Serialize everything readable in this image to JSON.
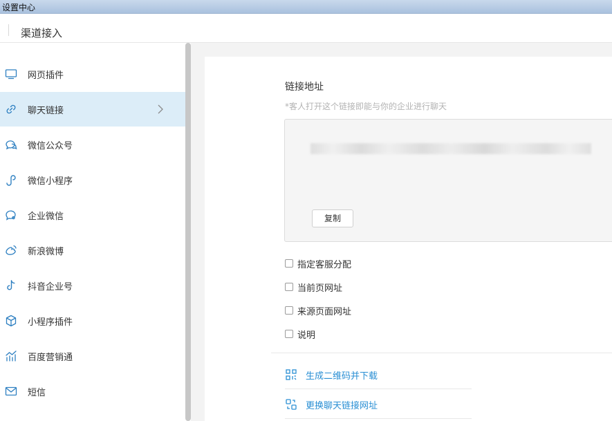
{
  "window": {
    "title": "设置中心"
  },
  "header": {
    "title": "渠道接入"
  },
  "sidebar": {
    "items": [
      {
        "label": "网页插件",
        "icon": "monitor-icon"
      },
      {
        "label": "聊天链接",
        "icon": "link-icon",
        "active": true
      },
      {
        "label": "微信公众号",
        "icon": "wechat-official-icon"
      },
      {
        "label": "微信小程序",
        "icon": "miniprogram-icon"
      },
      {
        "label": "企业微信",
        "icon": "wecom-icon"
      },
      {
        "label": "新浪微博",
        "icon": "weibo-icon"
      },
      {
        "label": "抖音企业号",
        "icon": "douyin-icon"
      },
      {
        "label": "小程序插件",
        "icon": "cube-icon"
      },
      {
        "label": "百度营销通",
        "icon": "chart-icon"
      },
      {
        "label": "短信",
        "icon": "mail-icon"
      }
    ]
  },
  "main": {
    "title": "链接地址",
    "hint": "*客人打开这个链接即能与你的企业进行聊天",
    "copy_label": "复制",
    "options": [
      {
        "label": "指定客服分配",
        "checked": false
      },
      {
        "label": "当前页网址",
        "checked": false
      },
      {
        "label": "来源页面网址",
        "checked": false
      },
      {
        "label": "说明",
        "checked": false
      }
    ],
    "actions": [
      {
        "label": "生成二维码并下载",
        "icon": "qrcode-icon"
      },
      {
        "label": "更换聊天链接网址",
        "icon": "swap-icon"
      }
    ]
  },
  "colors": {
    "accent": "#2a8fd4",
    "active_bg": "#dcedf8",
    "icon": "#2d7fc1"
  }
}
